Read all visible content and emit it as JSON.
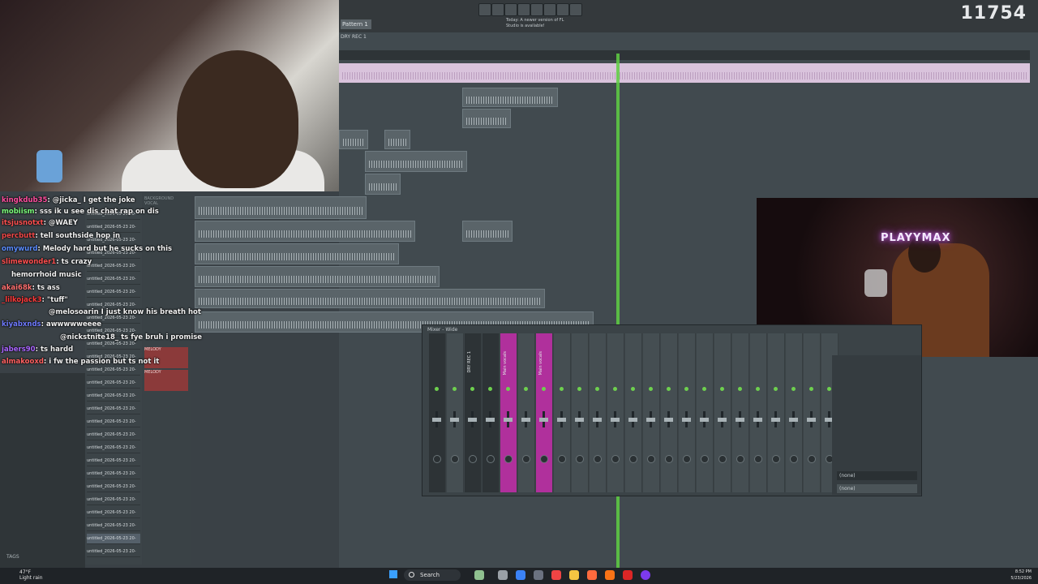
{
  "stream": {
    "viewer_count": "11754"
  },
  "fl_studio": {
    "pattern_label": "Pattern 1",
    "update_note": "Today: A newer version of FL Studio is available!",
    "playlist_title": "DRY REC 1"
  },
  "artist_cam": {
    "sign_text": "PLAYYMAX"
  },
  "chat": [
    {
      "user": "kingkdub35",
      "color": "#ff4fa0",
      "message": "@jicka_ I get the joke"
    },
    {
      "user": "mobiism",
      "color": "#7dff7d",
      "message": "sss ik u see dis chat rap on dis"
    },
    {
      "user": "itsjusnotxt",
      "color": "#ff5050",
      "message": "@WAEY"
    },
    {
      "user": "percbutt",
      "color": "#f04848",
      "message": "tell southside hop in"
    },
    {
      "user": "omywurd",
      "color": "#5a8cff",
      "message": "Melody hard but he sucks on this"
    },
    {
      "user": "slimewonder1",
      "color": "#ff4f4f",
      "message": "ts crazy"
    },
    {
      "user": "",
      "color": "#4a6dff",
      "message": "hemorrhoid music"
    },
    {
      "user": "akai68k",
      "color": "#ff6f6f",
      "message": "ts ass"
    },
    {
      "user": "_lilkojack3",
      "color": "#ff3a3a",
      "message": "\"tuff\""
    },
    {
      "user": "",
      "color": "#5a5aff",
      "message": "@melosoarin I just know his breath hot"
    },
    {
      "user": "kiyabxnds",
      "color": "#6f7bff",
      "message": "awwwwweeee"
    },
    {
      "user": "",
      "color": "#7a7aff",
      "message": "@nickstnite18_ ts fye bruh i promise"
    },
    {
      "user": "jabers90",
      "color": "#aa66ff",
      "message": "ts hardd"
    },
    {
      "user": "almakooxd",
      "color": "#ff6060",
      "message": "i fw the passion but ts not it"
    }
  ],
  "browser": {
    "file_prefix": "untitled_2026-05-23 20-",
    "tags_label": "TAGS",
    "background_vocal_label": "BACKGROUND VOCAL"
  },
  "tracks": {
    "melody_label": "MELODY"
  },
  "mixer": {
    "title": "Mixer - Wide",
    "pink_strip_label": "Main vocals",
    "dry_strip_label": "DRY REC 1",
    "slot_empty": "(none)"
  },
  "taskbar": {
    "weather_temp": "47°F",
    "weather_desc": "Light rain",
    "search_placeholder": "Search",
    "time": "8:52 PM",
    "date": "5/23/2026"
  }
}
